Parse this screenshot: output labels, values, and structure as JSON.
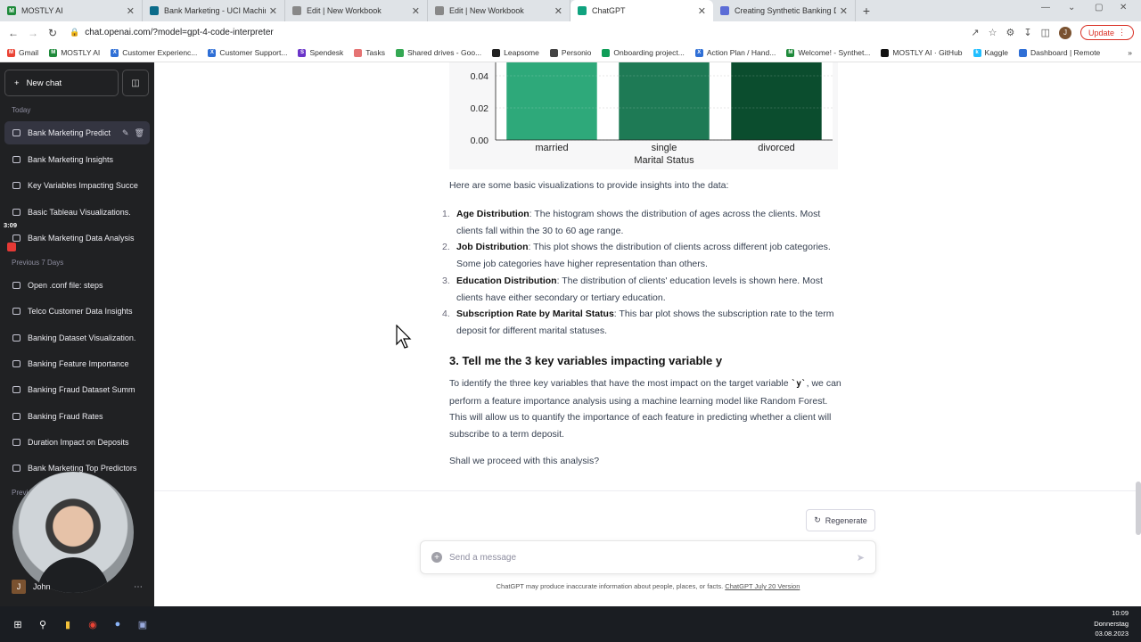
{
  "browser": {
    "tabs": [
      {
        "title": "MOSTLY AI",
        "icon_color": "#1f8a3b",
        "icon_letter": "M"
      },
      {
        "title": "Bank Marketing - UCI Machine Le",
        "icon_color": "#0b6b8a",
        "icon_letter": ""
      },
      {
        "title": "Edit | New Workbook",
        "icon_color": "#888888",
        "icon_letter": ""
      },
      {
        "title": "Edit | New Workbook",
        "icon_color": "#888888",
        "icon_letter": ""
      },
      {
        "title": "ChatGPT",
        "icon_color": "#10a37f",
        "icon_letter": ""
      },
      {
        "title": "Creating Synthetic Banking Data",
        "icon_color": "#5b6cd6",
        "icon_letter": ""
      }
    ],
    "new_tab": "+",
    "url": "chat.openai.com/?model=gpt-4-code-interpreter",
    "update_label": "Update",
    "avatar_letter": "J",
    "bookmarks": [
      {
        "label": "Gmail",
        "color": "#ea4335",
        "letter": "M"
      },
      {
        "label": "MOSTLY AI",
        "color": "#1f8a3b",
        "letter": "M"
      },
      {
        "label": "Customer Experienc...",
        "color": "#2f6fd6",
        "letter": "X"
      },
      {
        "label": "Customer Support...",
        "color": "#2f6fd6",
        "letter": "X"
      },
      {
        "label": "Spendesk",
        "color": "#6b35c9",
        "letter": "S"
      },
      {
        "label": "Tasks",
        "color": "#e57373",
        "letter": ""
      },
      {
        "label": "Shared drives - Goo...",
        "color": "#34a853",
        "letter": ""
      },
      {
        "label": "Leapsome",
        "color": "#222222",
        "letter": ""
      },
      {
        "label": "Personio",
        "color": "#444444",
        "letter": ""
      },
      {
        "label": "Onboarding project...",
        "color": "#0f9d58",
        "letter": ""
      },
      {
        "label": "Action Plan / Hand...",
        "color": "#2f6fd6",
        "letter": "X"
      },
      {
        "label": "Welcome! - Synthet...",
        "color": "#1f8a3b",
        "letter": "M"
      },
      {
        "label": "MOSTLY AI · GitHub",
        "color": "#111111",
        "letter": ""
      },
      {
        "label": "Kaggle",
        "color": "#20beff",
        "letter": "k"
      },
      {
        "label": "Dashboard | Remote",
        "color": "#2f6fd6",
        "letter": ""
      }
    ]
  },
  "sidebar": {
    "new_chat": "New chat",
    "today_label": "Today",
    "prev7_label": "Previous 7 Days",
    "prev_label": "Previ",
    "timer": "3:09",
    "today_items": [
      "Bank Marketing Predict",
      "Bank Marketing Insights",
      "Key Variables Impacting Succe",
      "Basic Tableau Visualizations.",
      "Bank Marketing Data Analysis"
    ],
    "prev7_items": [
      "Open .conf file: steps",
      "Telco Customer Data Insights",
      "Banking Dataset Visualization.",
      "Banking Feature Importance",
      "Banking Fraud Dataset Summ",
      "Banking Fraud Rates",
      "Duration Impact on Deposits",
      "Bank Marketing Top Predictors"
    ],
    "user_name": "John",
    "user_initial": "J"
  },
  "chart_data": {
    "type": "bar",
    "categories": [
      "married",
      "single",
      "divorced"
    ],
    "values": [
      0.101,
      0.14,
      0.121
    ],
    "xlabel": "Marital Status",
    "ylabel": "",
    "yticks": [
      "0.00",
      "0.02",
      "0.04"
    ],
    "ylim": [
      0,
      0.045
    ],
    "colors": [
      "#2ea97a",
      "#1e7a55",
      "#0b4d2e"
    ],
    "grid": true
  },
  "message": {
    "intro": "Here are some basic visualizations to provide insights into the data:",
    "points": [
      {
        "n": "1.",
        "title": "Age Distribution",
        "text": ": The histogram shows the distribution of ages across the clients. Most clients fall within the 30 to 60 age range."
      },
      {
        "n": "2.",
        "title": "Job Distribution",
        "text": ": This plot shows the distribution of clients across different job categories. Some job categories have higher representation than others."
      },
      {
        "n": "3.",
        "title": "Education Distribution",
        "text": ": The distribution of clients' education levels is shown here. Most clients have either secondary or tertiary education."
      },
      {
        "n": "4.",
        "title": "Subscription Rate by Marital Status",
        "text": ": This bar plot shows the subscription rate to the term deposit for different marital statuses."
      }
    ],
    "heading": "3. Tell me the 3 key variables impacting variable y",
    "para1_a": "To identify the three key variables that have the most impact on the target variable ",
    "para1_code": "`y`",
    "para1_b": ", we can perform a feature importance analysis using a machine learning model like Random Forest. This will allow us to quantify the importance of each feature in predicting whether a client will subscribe to a term deposit.",
    "para2": "Shall we proceed with this analysis?"
  },
  "composer": {
    "regenerate": "Regenerate",
    "placeholder": "Send a message",
    "disclaimer": "ChatGPT may produce inaccurate information about people, places, or facts.",
    "version_link": "ChatGPT July 20 Version"
  },
  "taskbar": {
    "time": "10:09",
    "day": "Donnerstag",
    "date": "03.08.2023"
  }
}
